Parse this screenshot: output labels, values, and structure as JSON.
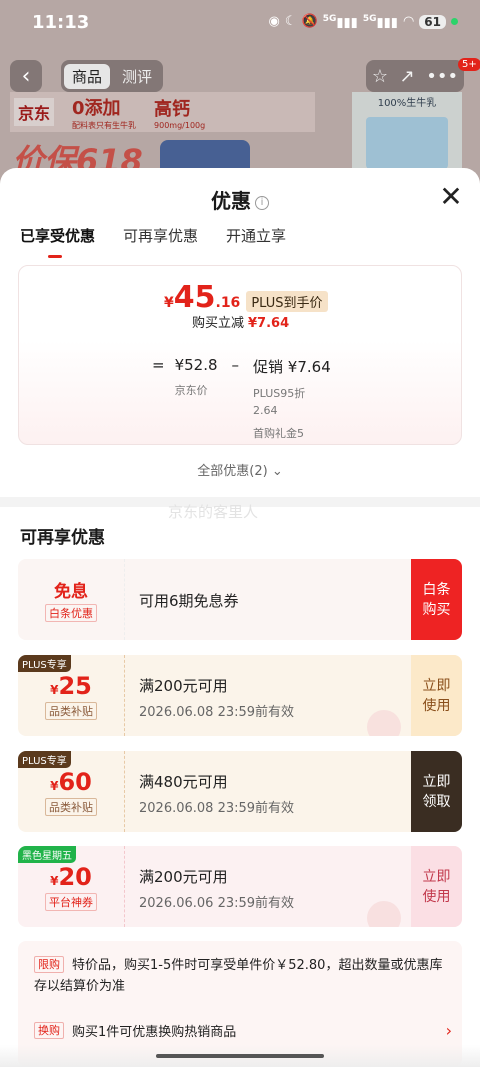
{
  "status_bar": {
    "time": "11:13",
    "signal1": "5G",
    "signal2": "5G",
    "battery": "61"
  },
  "product_page": {
    "tabs": [
      "商品",
      "测评"
    ],
    "badge": "5+",
    "banner": {
      "logo": "京东",
      "tag1": "0添加",
      "tag1_sub": "配料表只有生牛乳",
      "tag2": "高钙",
      "tag2_sub": "900mg/100g"
    },
    "promo_text": "价保618",
    "milk_label": "100%生牛乳"
  },
  "sheet": {
    "title": "优惠",
    "tabs": [
      "已享受优惠",
      "可再享优惠",
      "开通立享"
    ],
    "price": {
      "yen": "¥",
      "final_int": "45",
      "final_dec": ".16",
      "plus_badge": "PLUS到手价",
      "instant_label": "购买立减",
      "instant_value": "¥7.64",
      "eq": "=",
      "base_price": "¥52.8",
      "base_label": "京东价",
      "minus": "–",
      "promo": "促销 ¥7.64",
      "promo_detail1": "PLUS95折",
      "promo_detail2": "2.64",
      "promo_detail3": "首购礼金5"
    },
    "all_discounts": "全部优惠(2)",
    "watermark": "京东的客里人",
    "section_title": "可再享优惠",
    "coupons": [
      {
        "main": "免息",
        "tag": "白条优惠",
        "cond": "可用6期免息券",
        "btn1": "白条",
        "btn2": "购买"
      },
      {
        "corner": "PLUS专享",
        "yen": "¥",
        "amount": "25",
        "tag": "品类补贴",
        "cond": "满200元可用",
        "date": "2026.06.08 23:59前有效",
        "btn1": "立即",
        "btn2": "使用"
      },
      {
        "corner": "PLUS专享",
        "yen": "¥",
        "amount": "60",
        "tag": "品类补贴",
        "cond": "满480元可用",
        "date": "2026.06.08 23:59前有效",
        "btn1": "立即",
        "btn2": "领取"
      },
      {
        "corner": "黑色星期五",
        "yen": "¥",
        "amount": "20",
        "tag": "平台神券",
        "cond": "满200元可用",
        "date": "2026.06.06 23:59前有效",
        "btn1": "立即",
        "btn2": "使用"
      }
    ],
    "notes": [
      {
        "tag": "限购",
        "text": "特价品，购买1-5件时可享受单件价￥52.80，超出数量或优惠库存以结算价为准"
      },
      {
        "tag": "换购",
        "text": "购买1件可优惠换购热销商品"
      }
    ]
  },
  "colors": {
    "accent": "#e2231a",
    "plus_dark": "#5b3a1d",
    "green": "#21b34a"
  }
}
